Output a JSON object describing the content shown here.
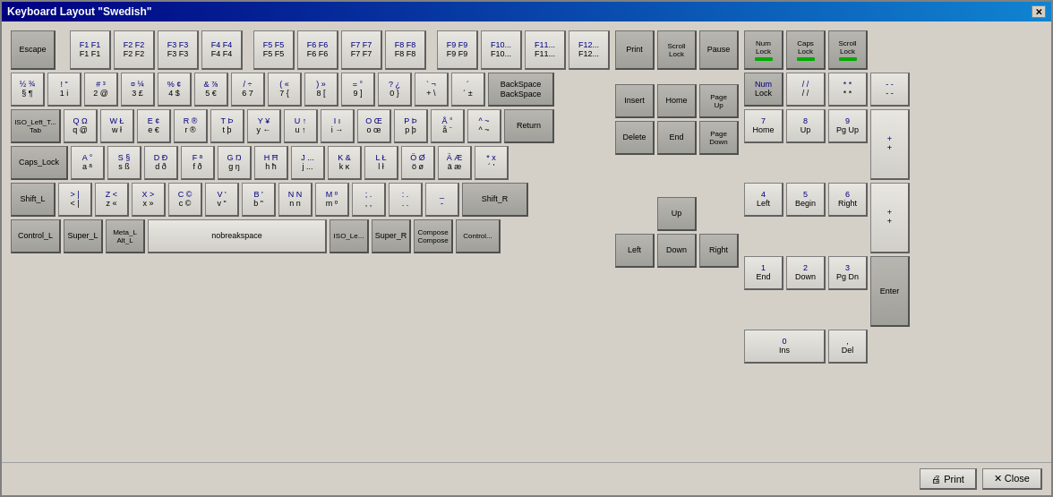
{
  "window": {
    "title": "Keyboard Layout \"Swedish\"",
    "close_label": "✕"
  },
  "buttons": {
    "print_label": "🖨 Print",
    "close_label": "✕ Close"
  },
  "keyboard": {
    "rows": []
  }
}
